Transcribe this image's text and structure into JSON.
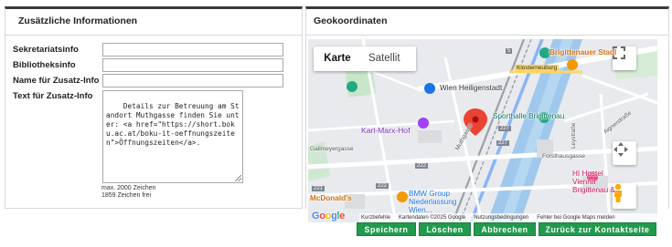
{
  "left_panel": {
    "title": "Zusätzliche Informationen",
    "fields": [
      {
        "label": "Sekretariatsinfo",
        "value": ""
      },
      {
        "label": "Bibliotheksinfo",
        "value": ""
      },
      {
        "label": "Name für Zusatz-Info",
        "value": ""
      }
    ],
    "textarea": {
      "label": "Text für Zusatz-Info",
      "value": "Details zur Betreuung am Standort Muthgasse finden Sie unter: <a href=\"https://short.boku.ac.at/boku-it-oeffnungszeiten\">Öffnungszeiten</a>.",
      "max_hint": "max. 2000 Zeichen",
      "free_hint": "1859 Zeichen frei"
    }
  },
  "right_panel": {
    "title": "Geokoordinaten",
    "map": {
      "tab_map": "Karte",
      "tab_satellite": "Satellit",
      "labels": {
        "brigittenauer_stadl": "Brigittenauer Stadl",
        "klosterneuburg": "Klosterneuburg",
        "wien_heiligenstadt": "Wien Heiligenstadt",
        "sporthalle": "Sporthalle Brigittenau",
        "karl_marx_hof": "Karl-Marx-Hof",
        "gallmeyergasse": "Gallmeyergasse",
        "muthgasse": "Muthgasse",
        "leystrasse": "Leystraße",
        "aignerstrasse": "Aignerstraße",
        "forsthausgasse": "Forsthausgasse",
        "hostel": "HI Hostel Vienna Brigittenau &...",
        "mcdonalds": "McDonald's",
        "bmw": "BMW Group Niederlassung Wien...",
        "road_227a": "227",
        "road_227b": "227",
        "road_222a": "222",
        "road_222b": "222",
        "road_221": "221",
        "road_5": "5"
      },
      "logo": "Google",
      "footer": [
        "Kurzbefehle",
        "Kartendaten ©2025 Google",
        "Nutzungsbedingungen",
        "Fehler bei Google Maps melden"
      ]
    }
  },
  "buttons": {
    "save": "Speichern",
    "delete": "Löschen",
    "cancel": "Abbrechen",
    "back": "Zurück zur Kontaktseite"
  },
  "colors": {
    "button_green": "#229a4d",
    "map_marker": "#ea4335",
    "transit_green": "#22a884",
    "rail_blue": "#8ab4f8"
  }
}
